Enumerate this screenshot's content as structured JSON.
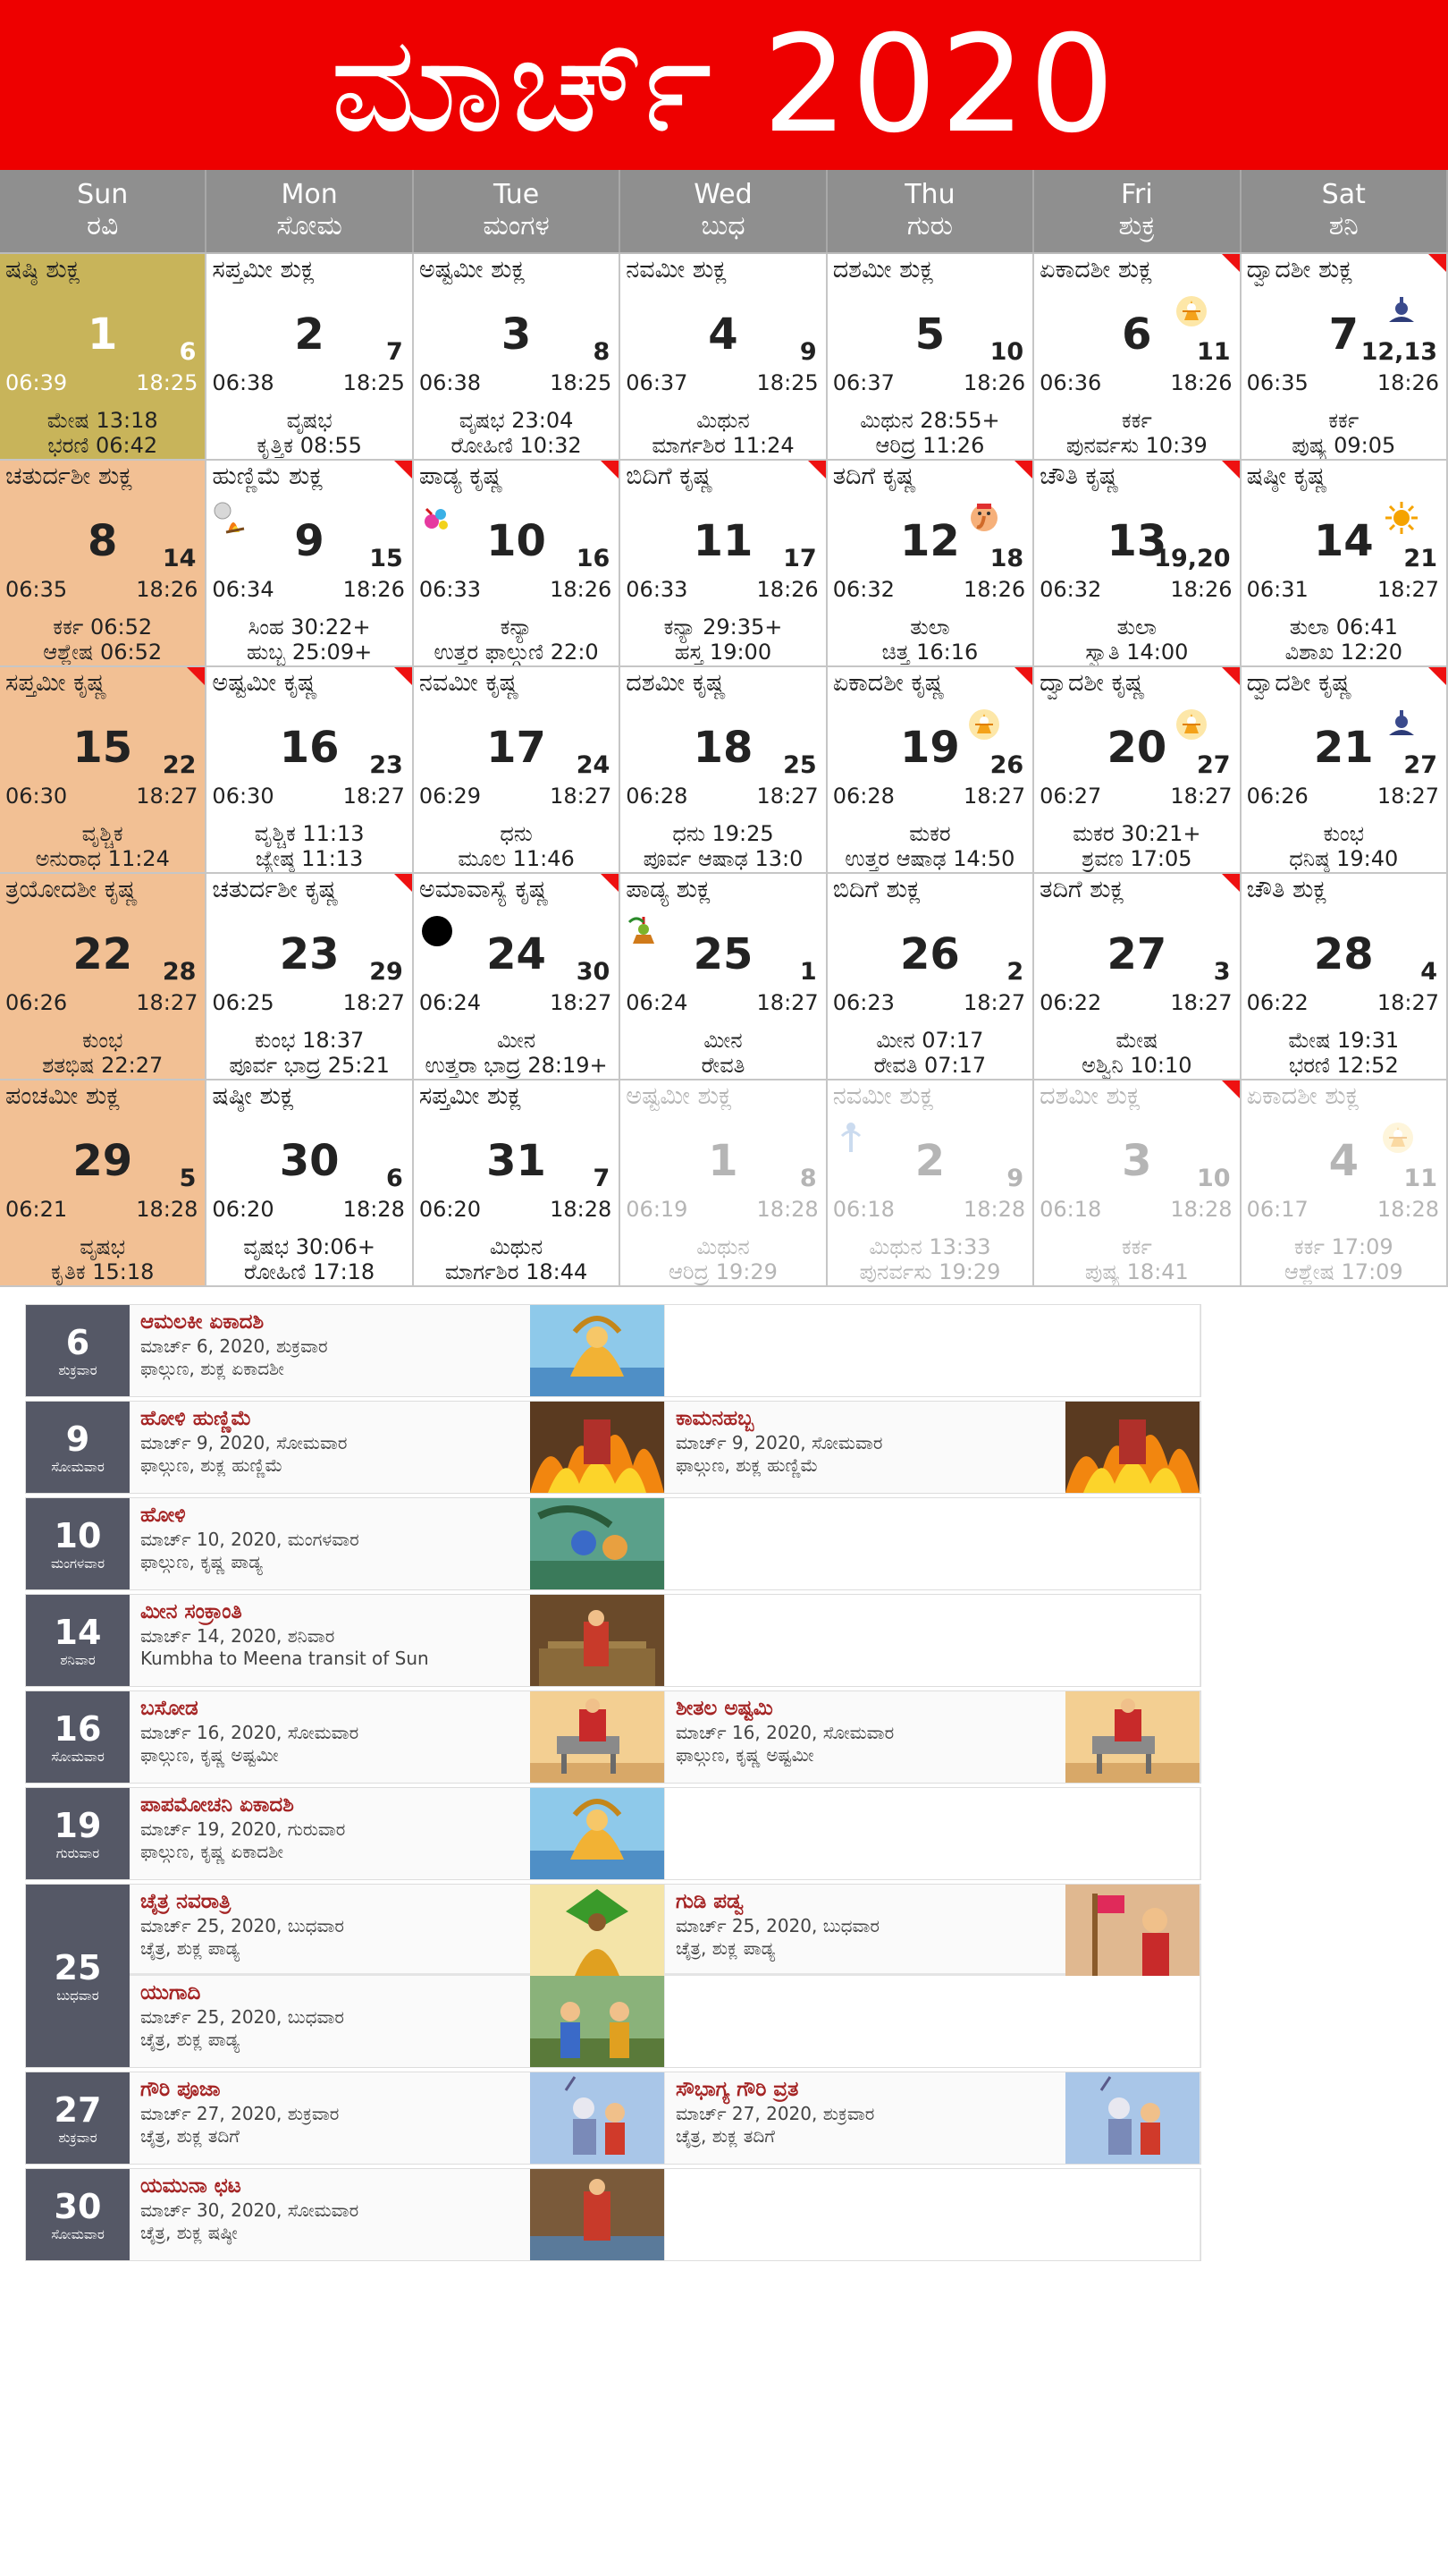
{
  "header": {
    "title": "ಮಾರ್ಚ್ 2020",
    "bg": "#ee0000"
  },
  "weekdays": [
    {
      "en": "Sun",
      "kn": "ರವಿ"
    },
    {
      "en": "Mon",
      "kn": "ಸೋಮ"
    },
    {
      "en": "Tue",
      "kn": "ಮಂಗಳ"
    },
    {
      "en": "Wed",
      "kn": "ಬುಧ"
    },
    {
      "en": "Thu",
      "kn": "ಗುರು"
    },
    {
      "en": "Fri",
      "kn": "ಶುಕ್ರ"
    },
    {
      "en": "Sat",
      "kn": "ಶನಿ"
    }
  ],
  "cells": [
    {
      "tithi": "ಷಷ್ಠಿ ಶುಕ್ಲ",
      "day": "1",
      "g": "6",
      "sr": "06:39",
      "ss": "18:25",
      "l1": "ಮೇಷ 13:18",
      "l2": "ಭರಣಿ 06:42",
      "type": "today"
    },
    {
      "tithi": "ಸಪ್ತಮೀ ಶುಕ್ಲ",
      "day": "2",
      "g": "7",
      "sr": "06:38",
      "ss": "18:25",
      "l1": "ವೃಷಭ",
      "l2": "ಕೃತ್ತಿಕ 08:55"
    },
    {
      "tithi": "ಅಷ್ಟಮೀ ಶುಕ್ಲ",
      "day": "3",
      "g": "8",
      "sr": "06:38",
      "ss": "18:25",
      "l1": "ವೃಷಭ 23:04",
      "l2": "ರೋಹಿಣಿ 10:32"
    },
    {
      "tithi": "ನವಮೀ ಶುಕ್ಲ",
      "day": "4",
      "g": "9",
      "sr": "06:37",
      "ss": "18:25",
      "l1": "ಮಿಥುನ",
      "l2": "ಮಾರ್ಗಶಿರ 11:24"
    },
    {
      "tithi": "ದಶಮೀ ಶುಕ್ಲ",
      "day": "5",
      "g": "10",
      "sr": "06:37",
      "ss": "18:26",
      "l1": "ಮಿಥುನ 28:55+",
      "l2": "ಆರಿದ್ರ 11:26"
    },
    {
      "tithi": "ಏಕಾದಶೀ ಶುಕ್ಲ",
      "day": "6",
      "g": "11",
      "sr": "06:36",
      "ss": "18:26",
      "l1": "ಕರ್ಕ",
      "l2": "ಪುನರ್ವಸು 10:39",
      "corner": true,
      "icon": "deity"
    },
    {
      "tithi": "ದ್ವಾದಶೀ ಶುಕ್ಲ",
      "day": "7",
      "g": "12,13",
      "sr": "06:35",
      "ss": "18:26",
      "l1": "ಕರ್ಕ",
      "l2": "ಪುಷ್ಯ 09:05",
      "corner": true,
      "icon": "shiva"
    },
    {
      "tithi": "ಚತುರ್ದಶೀ ಶುಕ್ಲ",
      "day": "8",
      "g": "14",
      "sr": "06:35",
      "ss": "18:26",
      "l1": "ಕರ್ಕ 06:52",
      "l2": "ಆಶ್ಲೇಷ 06:52",
      "type": "sun"
    },
    {
      "tithi": "ಹುಣ್ಣಿಮೆ ಶುಕ್ಲ",
      "day": "9",
      "g": "15",
      "sr": "06:34",
      "ss": "18:26",
      "l1": "ಸಿಂಹ 30:22+",
      "l2": "ಹುಬ್ಬ 25:09+",
      "corner": true,
      "icon": "moon-fire"
    },
    {
      "tithi": "ಪಾಡ್ಯ ಕೃಷ್ಣ",
      "day": "10",
      "g": "16",
      "sr": "06:33",
      "ss": "18:26",
      "l1": "ಕನ್ಯಾ",
      "l2": "ಉತ್ತರ ಫಾಲ್ಗುಣಿ 22:0",
      "corner": true,
      "icon": "colors"
    },
    {
      "tithi": "ಬಿದಿಗೆ ಕೃಷ್ಣ",
      "day": "11",
      "g": "17",
      "sr": "06:33",
      "ss": "18:26",
      "l1": "ಕನ್ಯಾ 29:35+",
      "l2": "ಹಸ್ತ 19:00",
      "corner": true
    },
    {
      "tithi": "ತದಿಗೆ ಕೃಷ್ಣ",
      "day": "12",
      "g": "18",
      "sr": "06:32",
      "ss": "18:26",
      "l1": "ತುಲಾ",
      "l2": "ಚಿತ್ತ 16:16",
      "corner": true,
      "icon": "ganesha"
    },
    {
      "tithi": "ಚೌತಿ ಕೃಷ್ಣ",
      "day": "13",
      "g": "19,20",
      "sr": "06:32",
      "ss": "18:26",
      "l1": "ತುಲಾ",
      "l2": "ಸ್ವಾತಿ 14:00",
      "corner": true
    },
    {
      "tithi": "ಷಷ್ಠೀ ಕೃಷ್ಣ",
      "day": "14",
      "g": "21",
      "sr": "06:31",
      "ss": "18:27",
      "l1": "ತುಲಾ 06:41",
      "l2": "ವಿಶಾಖ 12:20",
      "icon": "sun"
    },
    {
      "tithi": "ಸಪ್ತಮೀ ಕೃಷ್ಣ",
      "day": "15",
      "g": "22",
      "sr": "06:30",
      "ss": "18:27",
      "l1": "ವೃಶ್ಚಿಕ",
      "l2": "ಅನುರಾಧ 11:24",
      "type": "sun",
      "corner": true
    },
    {
      "tithi": "ಅಷ್ಟಮೀ ಕೃಷ್ಣ",
      "day": "16",
      "g": "23",
      "sr": "06:30",
      "ss": "18:27",
      "l1": "ವೃಶ್ಚಿಕ 11:13",
      "l2": "ಜ್ಯೇಷ್ಠ 11:13",
      "corner": true
    },
    {
      "tithi": "ನವಮೀ ಕೃಷ್ಣ",
      "day": "17",
      "g": "24",
      "sr": "06:29",
      "ss": "18:27",
      "l1": "ಧನು",
      "l2": "ಮೂಲ 11:46"
    },
    {
      "tithi": "ದಶಮೀ ಕೃಷ್ಣ",
      "day": "18",
      "g": "25",
      "sr": "06:28",
      "ss": "18:27",
      "l1": "ಧನು 19:25",
      "l2": "ಪೂರ್ವ ಆಷಾಢ 13:0"
    },
    {
      "tithi": "ಏಕಾದಶೀ ಕೃಷ್ಣ",
      "day": "19",
      "g": "26",
      "sr": "06:28",
      "ss": "18:27",
      "l1": "ಮಕರ",
      "l2": "ಉತ್ತರ ಆಷಾಢ 14:50",
      "corner": true,
      "icon": "deity"
    },
    {
      "tithi": "ದ್ವಾದಶೀ ಕೃಷ್ಣ",
      "day": "20",
      "g": "27",
      "sr": "06:27",
      "ss": "18:27",
      "l1": "ಮಕರ 30:21+",
      "l2": "ಶ್ರವಣ 17:05",
      "corner": true,
      "icon": "deity"
    },
    {
      "tithi": "ದ್ವಾದಶೀ ಕೃಷ್ಣ",
      "day": "21",
      "g": "27",
      "sr": "06:26",
      "ss": "18:27",
      "l1": "ಕುಂಭ",
      "l2": "ಧನಿಷ್ಠ 19:40",
      "corner": true,
      "icon": "shiva"
    },
    {
      "tithi": "ತ್ರಯೋದಶೀ ಕೃಷ್ಣ",
      "day": "22",
      "g": "28",
      "sr": "06:26",
      "ss": "18:27",
      "l1": "ಕುಂಭ",
      "l2": "ಶತಭಿಷ 22:27",
      "type": "sun"
    },
    {
      "tithi": "ಚತುರ್ದಶೀ ಕೃಷ್ಣ",
      "day": "23",
      "g": "29",
      "sr": "06:25",
      "ss": "18:27",
      "l1": "ಕುಂಭ 18:37",
      "l2": "ಪೂರ್ವ ಭಾದ್ರ 25:21",
      "corner": true
    },
    {
      "tithi": "ಅಮಾವಾಸ್ಯೆ ಕೃಷ್ಣ",
      "day": "24",
      "g": "30",
      "sr": "06:24",
      "ss": "18:27",
      "l1": "ಮೀನ",
      "l2": "ಉತ್ತರಾ ಭಾದ್ರ 28:19+",
      "corner": true,
      "icon": "newmoon"
    },
    {
      "tithi": "ಪಾಡ್ಯ ಶುಕ್ಲ",
      "day": "25",
      "g": "1",
      "sr": "06:24",
      "ss": "18:27",
      "l1": "ಮೀನ",
      "l2": "ರೇವತಿ",
      "icon": "ugadi"
    },
    {
      "tithi": "ಬಿದಿಗೆ ಶುಕ್ಲ",
      "day": "26",
      "g": "2",
      "sr": "06:23",
      "ss": "18:27",
      "l1": "ಮೀನ 07:17",
      "l2": "ರೇವತಿ 07:17"
    },
    {
      "tithi": "ತದಿಗೆ ಶುಕ್ಲ",
      "day": "27",
      "g": "3",
      "sr": "06:22",
      "ss": "18:27",
      "l1": "ಮೇಷ",
      "l2": "ಅಶ್ವಿನಿ 10:10",
      "corner": true
    },
    {
      "tithi": "ಚೌತಿ ಶುಕ್ಲ",
      "day": "28",
      "g": "4",
      "sr": "06:22",
      "ss": "18:27",
      "l1": "ಮೇಷ 19:31",
      "l2": "ಭರಣಿ 12:52"
    },
    {
      "tithi": "ಪಂಚಮೀ ಶುಕ್ಲ",
      "day": "29",
      "g": "5",
      "sr": "06:21",
      "ss": "18:28",
      "l1": "ವೃಷಭ",
      "l2": "ಕೃತಿಕ 15:18",
      "type": "sun"
    },
    {
      "tithi": "ಷಷ್ಠೀ ಶುಕ್ಲ",
      "day": "30",
      "g": "6",
      "sr": "06:20",
      "ss": "18:28",
      "l1": "ವೃಷಭ 30:06+",
      "l2": "ರೋಹಿಣಿ 17:18"
    },
    {
      "tithi": "ಸಪ್ತಮೀ ಶುಕ್ಲ",
      "day": "31",
      "g": "7",
      "sr": "06:20",
      "ss": "18:28",
      "l1": "ಮಿಥುನ",
      "l2": "ಮಾರ್ಗಶಿರ 18:44"
    },
    {
      "tithi": "ಅಷ್ಟಮೀ ಶುಕ್ಲ",
      "day": "1",
      "g": "8",
      "sr": "06:19",
      "ss": "18:28",
      "l1": "ಮಿಥುನ",
      "l2": "ಆರಿದ್ರ 19:29",
      "type": "other"
    },
    {
      "tithi": "ನವಮೀ ಶುಕ್ಲ",
      "day": "2",
      "g": "9",
      "sr": "06:18",
      "ss": "18:28",
      "l1": "ಮಿಥುನ 13:33",
      "l2": "ಪುನರ್ವಸು 19:29",
      "type": "other",
      "icon": "rama"
    },
    {
      "tithi": "ದಶಮೀ ಶುಕ್ಲ",
      "day": "3",
      "g": "10",
      "sr": "06:18",
      "ss": "18:28",
      "l1": "ಕರ್ಕ",
      "l2": "ಪುಷ್ಯ 18:41",
      "type": "other",
      "corner": true
    },
    {
      "tithi": "ಏಕಾದಶೀ ಶುಕ್ಲ",
      "day": "4",
      "g": "11",
      "sr": "06:17",
      "ss": "18:28",
      "l1": "ಕರ್ಕ 17:09",
      "l2": "ಆಶ್ಲೇಷ 17:09",
      "type": "other",
      "icon": "deity"
    }
  ],
  "events": [
    {
      "dn": "6",
      "dw": "ಶುಕ್ರವಾರ",
      "rows": [
        [
          {
            "name": "ಆಮಲಕೀ ಏಕಾದಶಿ",
            "date": "ಮಾರ್ಚ್ 6, 2020, ಶುಕ್ರವಾರ",
            "info": "ಫಾಲ್ಗುಣ, ಶುಕ್ಲ ಏಕಾದಶೀ",
            "pic": "vishnu"
          }
        ]
      ]
    },
    {
      "dn": "9",
      "dw": "ಸೋಮವಾರ",
      "rows": [
        [
          {
            "name": "ಹೋಳಿ ಹುಣ್ಣಿಮೆ",
            "date": "ಮಾರ್ಚ್ 9, 2020, ಸೋಮವಾರ",
            "info": "ಫಾಲ್ಗುಣ, ಶುಕ್ಲ ಹುಣ್ಣಿಮೆ",
            "pic": "fire"
          },
          {
            "name": "ಕಾಮನಹಬ್ಬ",
            "date": "ಮಾರ್ಚ್ 9, 2020, ಸೋಮವಾರ",
            "info": "ಫಾಲ್ಗುಣ, ಶುಕ್ಲ ಹುಣ್ಣಿಮೆ",
            "pic": "fire"
          }
        ]
      ]
    },
    {
      "dn": "10",
      "dw": "ಮಂಗಳವಾರ",
      "rows": [
        [
          {
            "name": "ಹೋಳಿ",
            "date": "ಮಾರ್ಚ್ 10, 2020, ಮಂಗಳವಾರ",
            "info": "ಫಾಲ್ಗುಣ, ಕೃಷ್ಣ ಪಾಡ್ಯ",
            "pic": "holi"
          }
        ]
      ]
    },
    {
      "dn": "14",
      "dw": "ಶನಿವಾರ",
      "rows": [
        [
          {
            "name": "ಮೀನ ಸಂಕ್ರಾಂತಿ",
            "date": "ಮಾರ್ಚ್ 14, 2020, ಶನಿವಾರ",
            "info": "Kumbha to Meena transit of Sun",
            "pic": "temple"
          }
        ]
      ]
    },
    {
      "dn": "16",
      "dw": "ಸೋಮವಾರ",
      "rows": [
        [
          {
            "name": "ಬಸೋಡ",
            "date": "ಮಾರ್ಚ್ 16, 2020, ಸೋಮವಾರ",
            "info": "ಫಾಲ್ಗುಣ, ಕೃಷ್ಣ ಅಷ್ಟಮೀ",
            "pic": "sheetala"
          },
          {
            "name": "ಶೀತಲ ಅಷ್ಟಮಿ",
            "date": "ಮಾರ್ಚ್ 16, 2020, ಸೋಮವಾರ",
            "info": "ಫಾಲ್ಗುಣ, ಕೃಷ್ಣ ಅಷ್ಟಮೀ",
            "pic": "sheetala"
          }
        ]
      ]
    },
    {
      "dn": "19",
      "dw": "ಗುರುವಾರ",
      "rows": [
        [
          {
            "name": "ಪಾಪಮೋಚನಿ ಏಕಾದಶಿ",
            "date": "ಮಾರ್ಚ್ 19, 2020, ಗುರುವಾರ",
            "info": "ಫಾಲ್ಗುಣ, ಕೃಷ್ಣ ಏಕಾದಶೀ",
            "pic": "vishnu"
          }
        ]
      ]
    },
    {
      "dn": "25",
      "dw": "ಬುಧವಾರ",
      "rows": [
        [
          {
            "name": "ಚೈತ್ರ ನವರಾತ್ರಿ",
            "date": "ಮಾರ್ಚ್ 25, 2020, ಬುಧವಾರ",
            "info": "ಚೈತ್ರ, ಶುಕ್ಲ ಪಾಡ್ಯ",
            "pic": "kalash"
          },
          {
            "name": "ಗುಡಿ ಪಡ್ವ",
            "date": "ಮಾರ್ಚ್ 25, 2020, ಬುಧವಾರ",
            "info": "ಚೈತ್ರ, ಶುಕ್ಲ ಪಾಡ್ಯ",
            "pic": "gudi"
          }
        ],
        [
          {
            "name": "ಯುಗಾದಿ",
            "date": "ಮಾರ್ಚ್ 25, 2020, ಬುಧವಾರ",
            "info": "ಚೈತ್ರ, ಶುಕ್ಲ ಪಾಡ್ಯ",
            "pic": "ugadi"
          }
        ]
      ]
    },
    {
      "dn": "27",
      "dw": "ಶುಕ್ರವಾರ",
      "rows": [
        [
          {
            "name": "ಗೌರಿ ಪೂಜಾ",
            "date": "ಮಾರ್ಚ್ 27, 2020, ಶುಕ್ರವಾರ",
            "info": "ಚೈತ್ರ, ಶುಕ್ಲ ತದಿಗೆ",
            "pic": "gauri"
          },
          {
            "name": "ಸೌಭಾಗ್ಯ ಗೌರಿ ವ್ರತ",
            "date": "ಮಾರ್ಚ್ 27, 2020, ಶುಕ್ರವಾರ",
            "info": "ಚೈತ್ರ, ಶುಕ್ಲ ತದಿಗೆ",
            "pic": "gauri"
          }
        ]
      ]
    },
    {
      "dn": "30",
      "dw": "ಸೋಮವಾರ",
      "rows": [
        [
          {
            "name": "ಯಮುನಾ ಛಟ",
            "date": "ಮಾರ್ಚ್ 30, 2020, ಸೋಮವಾರ",
            "info": "ಚೈತ್ರ, ಶುಕ್ಲ ಷಷ್ಠೀ",
            "pic": "yamuna"
          }
        ]
      ]
    }
  ]
}
